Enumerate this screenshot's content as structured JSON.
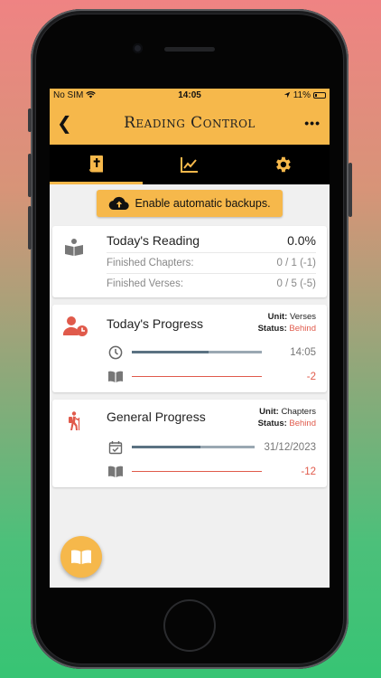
{
  "status_bar": {
    "carrier": "No SIM",
    "time": "14:05",
    "battery": "11%"
  },
  "app_bar": {
    "title": "Reading Control",
    "more": "•••"
  },
  "tabs": [
    {
      "icon": "bible-book-icon",
      "active": true
    },
    {
      "icon": "chart-line-icon",
      "active": false
    },
    {
      "icon": "gear-icon",
      "active": false
    }
  ],
  "backup": {
    "label": "Enable automatic backups."
  },
  "todays_reading": {
    "title": "Today's Reading",
    "percent": "0.0%",
    "rows": [
      {
        "label": "Finished Chapters:",
        "value": "0 / 1 (-1)"
      },
      {
        "label": "Finished Verses:",
        "value": "0 / 5 (-5)"
      }
    ]
  },
  "todays_progress": {
    "title": "Today's Progress",
    "unit_label": "Unit:",
    "unit_value": "Verses",
    "status_label": "Status:",
    "status_value": "Behind",
    "time_value": "14:05",
    "time_fill": 0.59,
    "reading_value": "-2",
    "reading_fill": 0
  },
  "general_progress": {
    "title": "General Progress",
    "unit_label": "Unit:",
    "unit_value": "Chapters",
    "status_label": "Status:",
    "status_value": "Behind",
    "date_value": "31/12/2023",
    "date_fill": 0.56,
    "reading_value": "-12",
    "reading_fill": 0
  },
  "colors": {
    "accent": "#f6b84b",
    "behind": "#e05a4b",
    "bar": "#5b7282"
  }
}
